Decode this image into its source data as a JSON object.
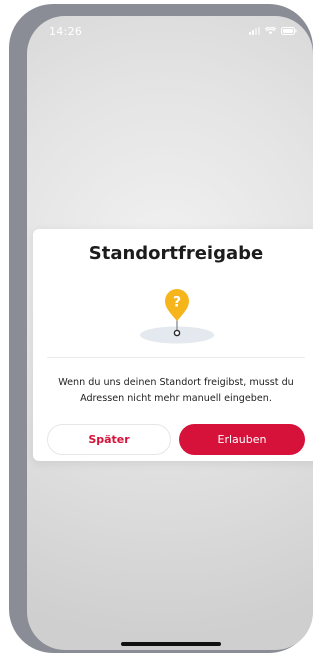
{
  "status_bar": {
    "time": "14:26"
  },
  "dialog": {
    "title": "Standortfreigabe",
    "message": "Wenn du uns deinen Standort freigibst, musst du Adressen nicht mehr manuell eingeben.",
    "later_label": "Später",
    "allow_label": "Erlauben",
    "illustration_icon": "location-pin-question-icon"
  },
  "colors": {
    "accent": "#d6123a",
    "pin": "#f5b51b",
    "pin_glyph": "#ffffff",
    "shadow": "#e3e9ee"
  }
}
